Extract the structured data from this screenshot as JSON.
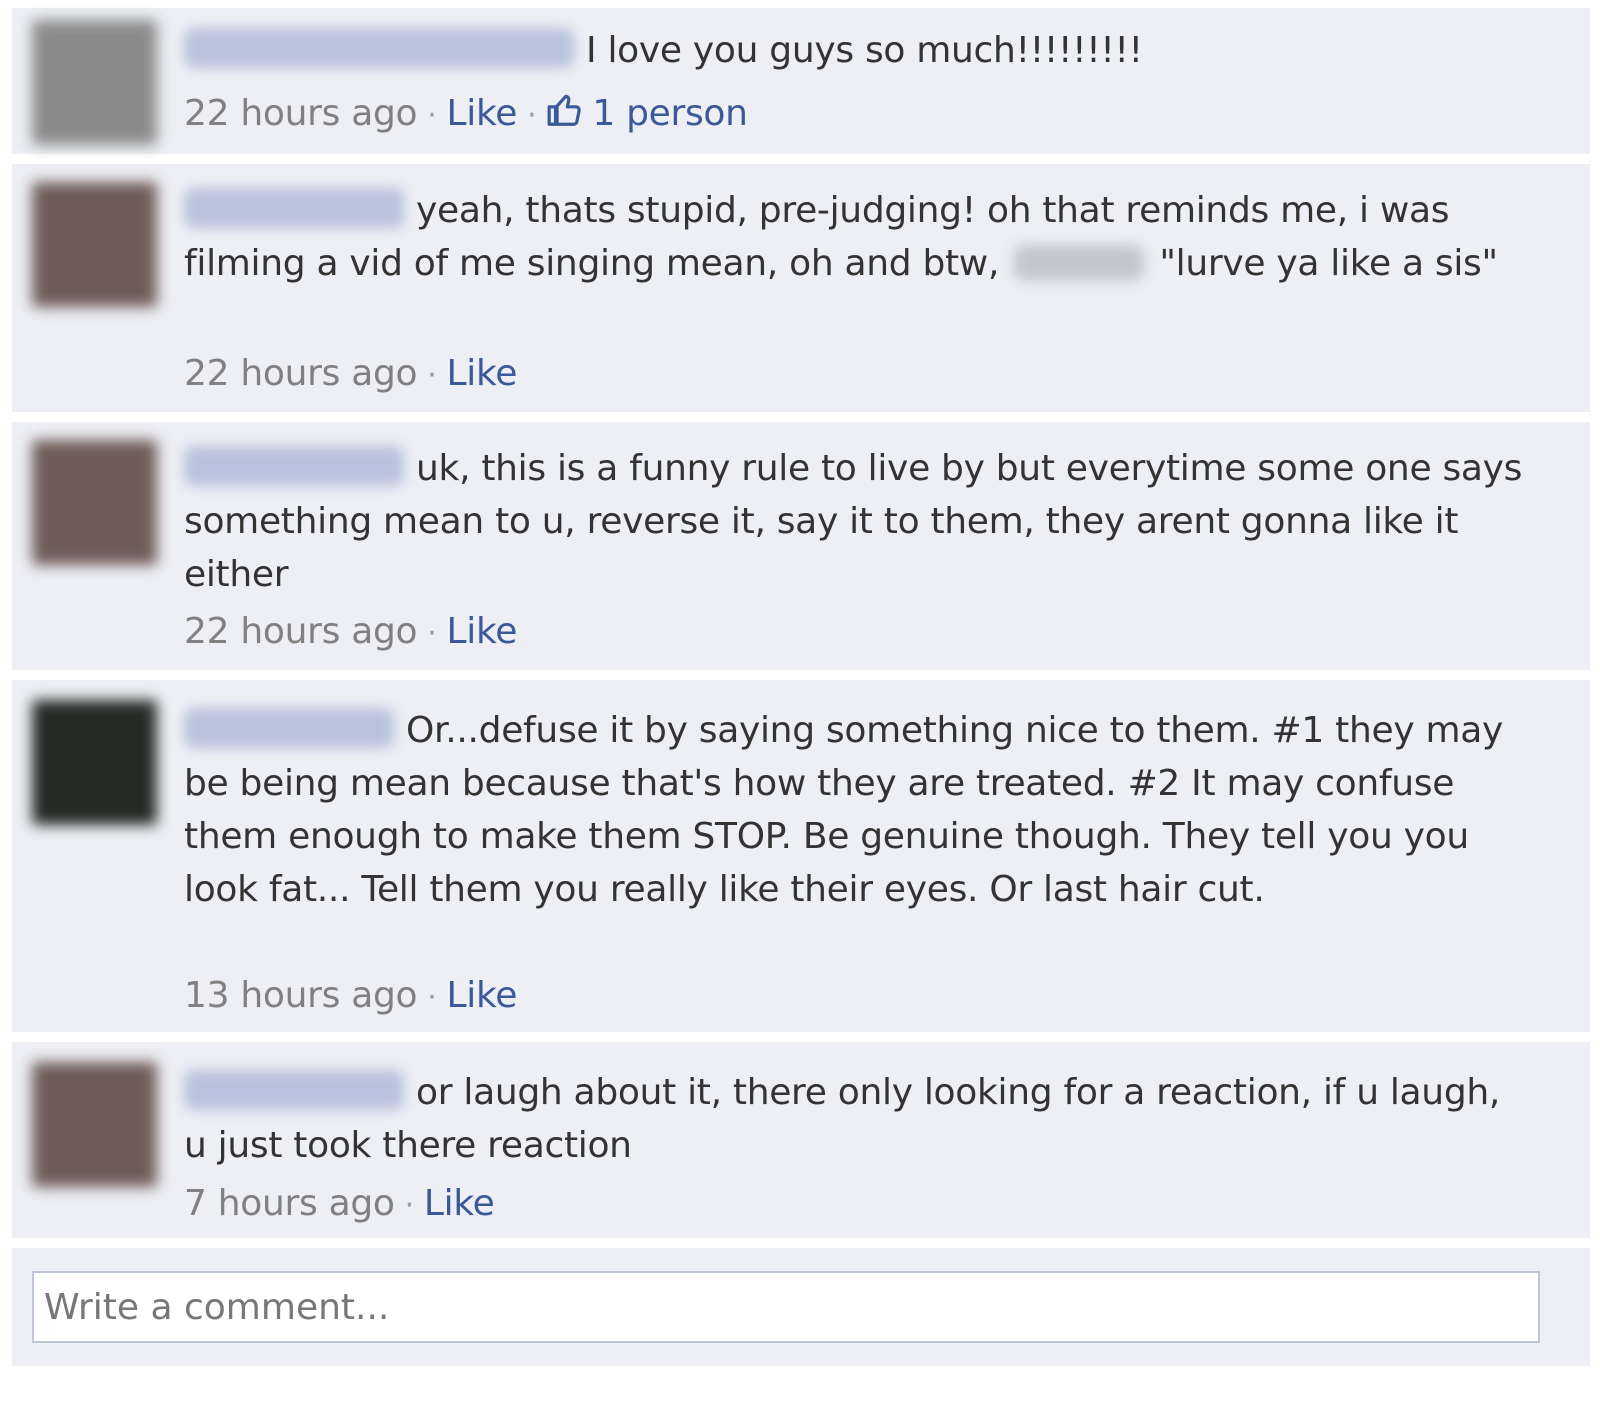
{
  "comments": [
    {
      "text": "I love you guys so much!!!!!!!!!",
      "time": "22 hours ago",
      "like_label": "Like",
      "likes_count_label": "1 person",
      "avatar_color": "#8a8a8a"
    },
    {
      "text_before_mention": "yeah, thats stupid, pre-judging! oh that reminds me, i was filming a vid of me singing mean, oh and btw,",
      "text_after_mention": "\"lurve ya like a sis\"",
      "time": "22 hours ago",
      "like_label": "Like",
      "avatar_color": "#6e5b58"
    },
    {
      "text": "uk, this is a funny rule to live by but everytime some one says something mean to u, reverse it, say it to them, they arent gonna like it either",
      "time": "22 hours ago",
      "like_label": "Like",
      "avatar_color": "#6e5b58"
    },
    {
      "text": "Or...defuse it by saying something nice to them.  #1 they may be being mean because that's how they are treated.  #2 It may confuse them enough to make them STOP. Be genuine though. They tell you you look fat... Tell them you really like their eyes. Or last hair cut.",
      "time": "13 hours ago",
      "like_label": "Like",
      "avatar_color": "#262a26"
    },
    {
      "text": "or laugh about it, there only looking for a reaction, if u laugh, u just took there reaction",
      "time": "7 hours ago",
      "like_label": "Like",
      "avatar_color": "#6e5b58"
    }
  ],
  "composer": {
    "placeholder": "Write a comment..."
  },
  "colors": {
    "background": "#edeff4",
    "link": "#3b5998",
    "timestamp": "#808080",
    "input_border": "#bdc7d8"
  }
}
